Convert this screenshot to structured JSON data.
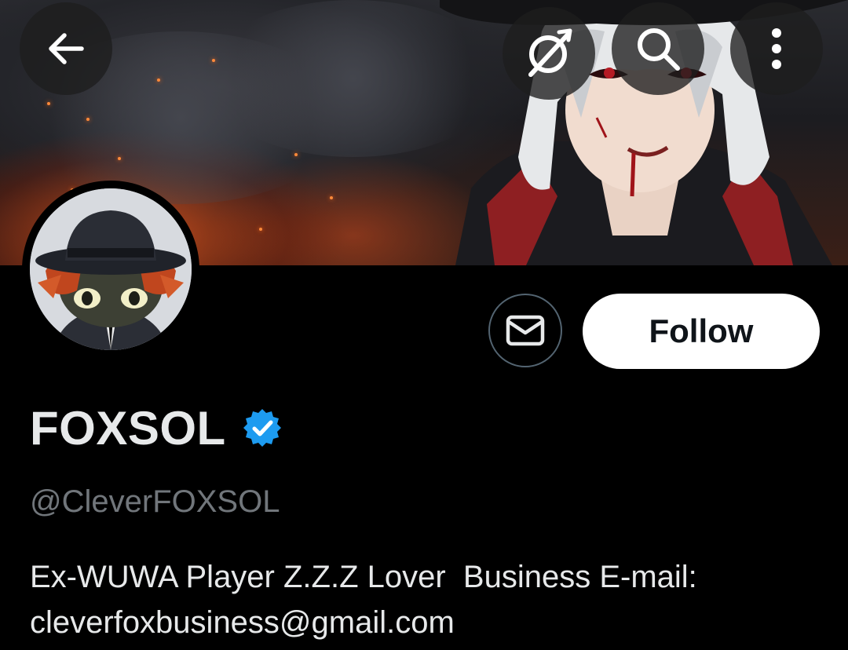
{
  "header": {
    "back_icon": "arrow-left-icon",
    "grok_icon": "grok-icon",
    "search_icon": "search-icon",
    "more_icon": "more-vertical-icon"
  },
  "profile": {
    "display_name": "FOXSOL",
    "verified": true,
    "verified_color": "#1d9bf0",
    "handle": "@CleverFOXSOL",
    "bio_line1": "Ex-WUWA Player Z.Z.Z Lover  Business E-mail:",
    "bio_line2": "cleverfoxbusiness@gmail.com"
  },
  "actions": {
    "message_icon": "envelope-icon",
    "follow_label": "Follow"
  },
  "colors": {
    "background": "#000000",
    "text_primary": "#e7e9ea",
    "text_secondary": "#71767b",
    "follow_bg": "#ffffff",
    "follow_text": "#0f1419"
  }
}
